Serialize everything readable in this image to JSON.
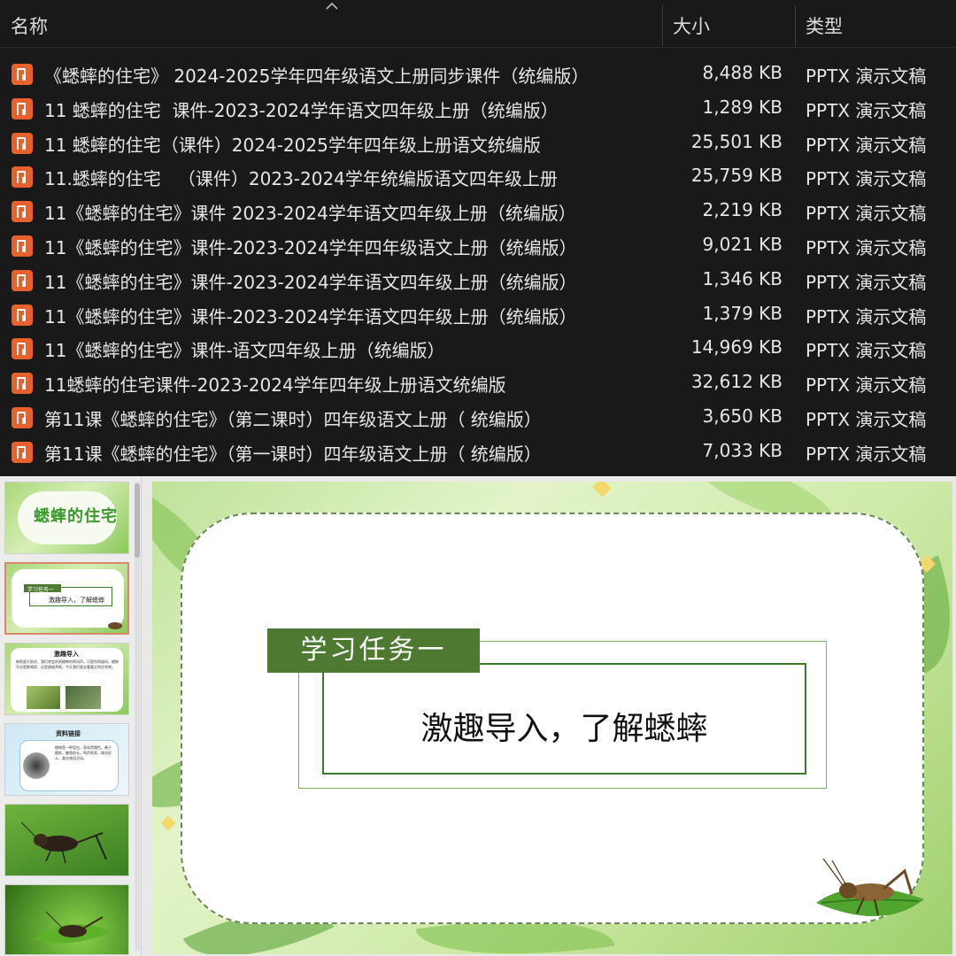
{
  "explorer": {
    "columns": {
      "name": "名称",
      "size": "大小",
      "type": "类型"
    },
    "files": [
      {
        "name": "《蟋蟀的住宅》 2024-2025学年四年级语文上册同步课件（统编版）",
        "size": "8,488 KB",
        "type": "PPTX 演示文稿"
      },
      {
        "name": "11 蟋蟀的住宅  课件-2023-2024学年语文四年级上册（统编版）",
        "size": "1,289 KB",
        "type": "PPTX 演示文稿"
      },
      {
        "name": "11 蟋蟀的住宅（课件）2024-2025学年四年级上册语文统编版",
        "size": "25,501 KB",
        "type": "PPTX 演示文稿"
      },
      {
        "name": "11.蟋蟀的住宅   （课件）2023-2024学年统编版语文四年级上册",
        "size": "25,759 KB",
        "type": "PPTX 演示文稿"
      },
      {
        "name": "11《蟋蟀的住宅》课件 2023-2024学年语文四年级上册（统编版）",
        "size": "2,219 KB",
        "type": "PPTX 演示文稿"
      },
      {
        "name": "11《蟋蟀的住宅》课件-2023-2024学年四年级语文上册（统编版）",
        "size": "9,021 KB",
        "type": "PPTX 演示文稿"
      },
      {
        "name": "11《蟋蟀的住宅》课件-2023-2024学年语文四年级上册（统编版）",
        "size": "1,346 KB",
        "type": "PPTX 演示文稿"
      },
      {
        "name": "11《蟋蟀的住宅》课件-2023-2024学年语文四年级上册（统编版）",
        "size": "1,379 KB",
        "type": "PPTX 演示文稿"
      },
      {
        "name": "11《蟋蟀的住宅》课件-语文四年级上册（统编版）",
        "size": "14,969 KB",
        "type": "PPTX 演示文稿"
      },
      {
        "name": "11蟋蟀的住宅课件-2023-2024学年四年级上册语文统编版",
        "size": "32,612 KB",
        "type": "PPTX 演示文稿"
      },
      {
        "name": "第11课《蟋蟀的住宅》（第二课时）四年级语文上册（ 统编版）",
        "size": "3,650 KB",
        "type": "PPTX 演示文稿"
      },
      {
        "name": "第11课《蟋蟀的住宅》（第一课时）四年级语文上册（ 统编版）",
        "size": "7,033 KB",
        "type": "PPTX 演示文稿"
      }
    ],
    "icon": "pptx-file-icon",
    "colors": {
      "icon_orange": "#e8612c",
      "text": "#e6e6e6",
      "background": "#191919"
    }
  },
  "thumbnails": [
    {
      "title": "蟋蟀的住宅"
    },
    {
      "tag": "学习任务一",
      "caption": "激趣导入，了解蟋蟀"
    },
    {
      "heading": "激趣导入",
      "body": "每到夏天秋初，我们常会听到蟋蟀的鸣叫声。可是你知道吗，蟋蟀不仅是歌唱家，还是建筑师呢。今天我们就去看看它的住宅吧。"
    },
    {
      "heading": "资料链接",
      "body": "蟋蟀是一种昆虫，身体黑褐色，善于跳跃，触角很长，鸣声悦耳，雄虫好斗，喜在夜间活动。"
    },
    {
      "kind": "photo-cricket"
    },
    {
      "kind": "photo-cricket-leaf"
    }
  ],
  "slide": {
    "task_label": "学习任务一",
    "task_title": "激趣导入，了解蟋蟀",
    "colors": {
      "tag": "#4d7a30",
      "frame": "#3f7a2c",
      "background": "#cfeaa9"
    }
  }
}
